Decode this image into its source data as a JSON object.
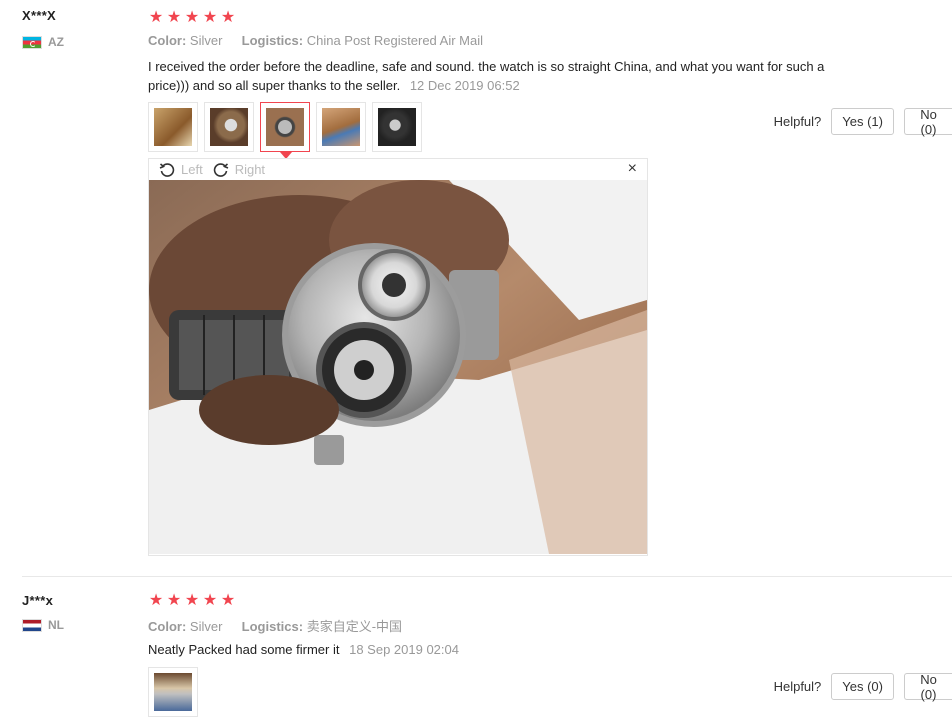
{
  "reviews": [
    {
      "user": "X***X",
      "country": "AZ",
      "rating": 5,
      "color_label": "Color:",
      "color_value": "Silver",
      "logistics_label": "Logistics:",
      "logistics_value": "China Post Registered Air Mail",
      "text": "I received the order before the deadline, safe and sound. the watch is so straight China, and what you want for such a price))) and so all super thanks to the seller.",
      "date": "12 Dec 2019 06:52",
      "helpful_label": "Helpful?",
      "yes_label": "Yes (1)",
      "no_label": "No (0)",
      "viewer": {
        "rotate_left": "Left",
        "rotate_right": "Right",
        "close": "×"
      }
    },
    {
      "user": "J***x",
      "country": "NL",
      "rating": 5,
      "color_label": "Color:",
      "color_value": "Silver",
      "logistics_label": "Logistics:",
      "logistics_value": "卖家自定义-中国",
      "text": "Neatly Packed had some firmer it",
      "date": "18 Sep 2019 02:04",
      "helpful_label": "Helpful?",
      "yes_label": "Yes (0)",
      "no_label": "No (0)"
    }
  ],
  "icons": {
    "star": "★",
    "rotate_left": "rotate-left-icon",
    "rotate_right": "rotate-right-icon",
    "close": "close-icon"
  },
  "colors": {
    "star": "#f1454f",
    "active_thumb": "#f1454f",
    "muted": "#999999"
  }
}
